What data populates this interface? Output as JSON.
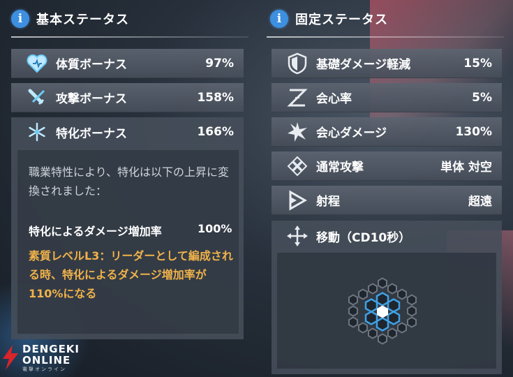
{
  "basic": {
    "title": "基本ステータス",
    "rows": [
      {
        "label": "体質ボーナス",
        "value": "97%"
      },
      {
        "label": "攻撃ボーナス",
        "value": "158%"
      },
      {
        "label": "特化ボーナス",
        "value": "166%"
      }
    ],
    "description": "職業特性により、特化は以下の上昇に変換されました：",
    "conversion_label": "特化によるダメージ増加率",
    "conversion_value": "100%",
    "skill_note": "素質レベルL3：リーダーとして編成される時、特化によるダメージ増加率が110%になる"
  },
  "fixed": {
    "title": "固定ステータス",
    "rows": [
      {
        "label": "基礎ダメージ軽減",
        "value": "15%"
      },
      {
        "label": "会心率",
        "value": "5%"
      },
      {
        "label": "会心ダメージ",
        "value": "130%"
      },
      {
        "label": "通常攻撃",
        "value": "単体 対空"
      },
      {
        "label": "射程",
        "value": "超遠"
      }
    ],
    "movement_label": "移動（CD10秒）"
  },
  "watermark": {
    "line1": "DENGEKI",
    "line2": "ONLINE",
    "line3": "電撃オンライン"
  },
  "colors": {
    "accent_blue": "#3d8fe0",
    "skill_orange": "#f0b24a",
    "hex_blue": "#3fa2e6"
  },
  "icons": [
    "info-icon",
    "heart-icon",
    "sword-icon",
    "snowflake-icon",
    "shield-icon",
    "crit-rate-icon",
    "burst-icon",
    "diamond-pattern-icon",
    "range-icon",
    "move-arrows-icon"
  ]
}
